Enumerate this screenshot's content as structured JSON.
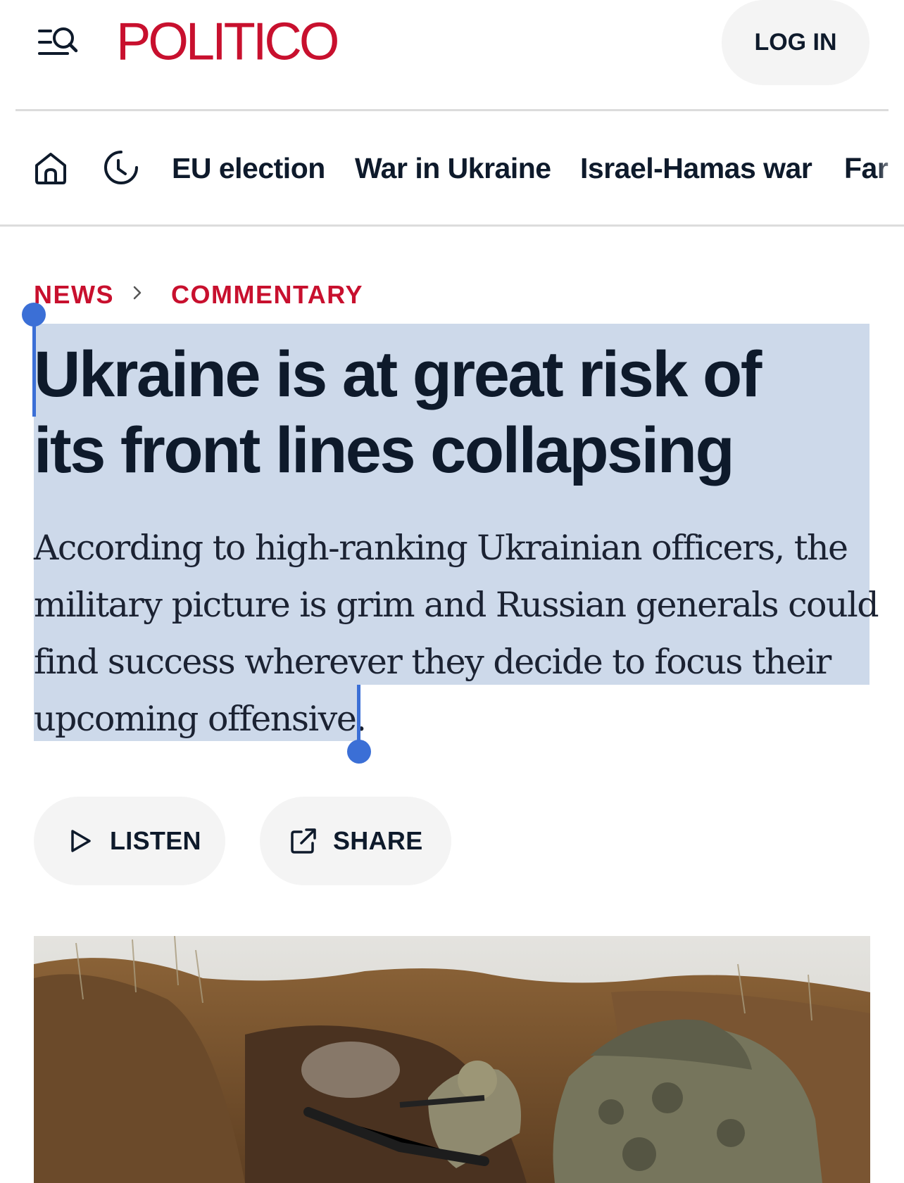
{
  "header": {
    "logo": "POLITICO",
    "login_label": "LOG IN",
    "menu_icon": "menu-search-icon",
    "brand_color": "#c8102e"
  },
  "nav": {
    "home_icon": "home-icon",
    "latest_icon": "clock-icon",
    "items": [
      {
        "label": "EU election"
      },
      {
        "label": "War in Ukraine"
      },
      {
        "label": "Israel-Hamas war"
      },
      {
        "label": "Far"
      }
    ]
  },
  "breadcrumb": {
    "section": "NEWS",
    "subsection": "COMMENTARY"
  },
  "article": {
    "headline": "Ukraine is at great risk of its front lines collapsing",
    "dek": "According to high-ranking Ukrainian officers, the military picture is grim and Russian generals could find success wherever they decide to focus their upcoming offensive.",
    "selection_color": "#cdd9ea",
    "handle_color": "#3b6fd6"
  },
  "actions": {
    "listen_label": "LISTEN",
    "listen_icon": "play-icon",
    "share_label": "SHARE",
    "share_icon": "share-external-icon"
  }
}
